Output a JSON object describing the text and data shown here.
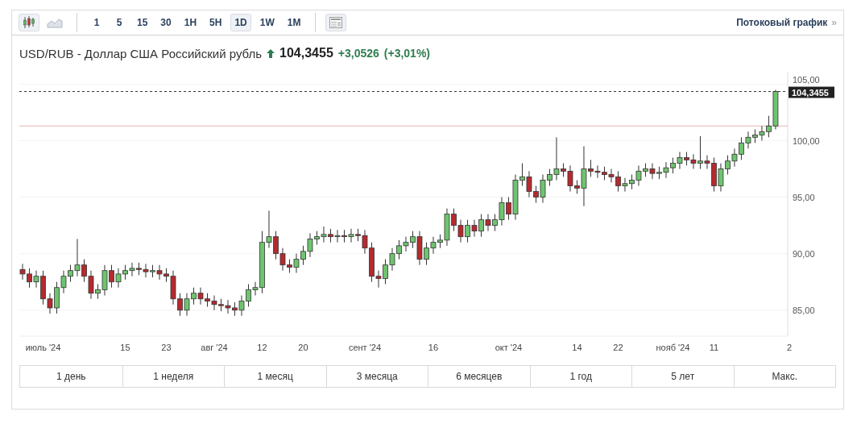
{
  "toolbar": {
    "chart_types": [
      {
        "kind": "candlestick",
        "selected": true
      },
      {
        "kind": "area",
        "selected": false
      }
    ],
    "intervals": [
      {
        "label": "1",
        "selected": false
      },
      {
        "label": "5",
        "selected": false
      },
      {
        "label": "15",
        "selected": false
      },
      {
        "label": "30",
        "selected": false
      },
      {
        "label": "1H",
        "selected": false
      },
      {
        "label": "5H",
        "selected": false
      },
      {
        "label": "1D",
        "selected": true
      },
      {
        "label": "1W",
        "selected": false
      },
      {
        "label": "1M",
        "selected": false
      }
    ],
    "streaming_link": {
      "label": "Потоковый график",
      "arrow": "»"
    }
  },
  "quote": {
    "pair": "USD/RUB - Доллар США Российский рубль",
    "price": "104,3455",
    "change": "+3,0526",
    "change_percent": "(+3,01%)"
  },
  "chart": {
    "chart_data": {
      "type": "candlestick",
      "ylim": [
        82.7,
        106.1
      ],
      "yticks": [
        {
          "value": 85,
          "label": "85,00"
        },
        {
          "value": 90,
          "label": "90,00"
        },
        {
          "value": 95,
          "label": "95,00"
        },
        {
          "value": 100,
          "label": "100,00"
        },
        {
          "value": 105,
          "label": "105,00"
        }
      ],
      "categories": [
        null,
        null,
        null,
        "июль '24",
        null,
        null,
        null,
        null,
        null,
        null,
        null,
        null,
        null,
        null,
        null,
        "15",
        null,
        null,
        null,
        null,
        null,
        "23",
        null,
        null,
        null,
        null,
        null,
        null,
        "авг '24",
        null,
        null,
        null,
        null,
        null,
        null,
        "12",
        null,
        null,
        null,
        null,
        null,
        "20",
        null,
        null,
        null,
        null,
        null,
        null,
        null,
        null,
        "сент '24",
        null,
        null,
        null,
        null,
        null,
        null,
        null,
        null,
        null,
        "16",
        null,
        null,
        null,
        null,
        null,
        null,
        null,
        null,
        null,
        null,
        "окт '24",
        null,
        null,
        null,
        null,
        null,
        null,
        null,
        null,
        null,
        "14",
        null,
        null,
        null,
        null,
        null,
        "22",
        null,
        null,
        null,
        null,
        null,
        null,
        null,
        "нояб '24",
        null,
        null,
        null,
        null,
        null,
        "11",
        null,
        null,
        null,
        null,
        null,
        null,
        null,
        null,
        null,
        null,
        "2"
      ],
      "ohlc": [
        [
          88.6,
          89.1,
          87.7,
          88.2
        ],
        [
          88.2,
          88.7,
          87.0,
          87.5
        ],
        [
          87.5,
          88.5,
          87.0,
          88.0
        ],
        [
          88.0,
          88.5,
          85.5,
          86.0
        ],
        [
          86.0,
          86.5,
          84.7,
          85.2
        ],
        [
          85.2,
          87.5,
          84.7,
          87.0
        ],
        [
          87.0,
          88.5,
          86.5,
          88.0
        ],
        [
          88.0,
          89.0,
          87.5,
          88.5
        ],
        [
          88.5,
          91.3,
          88.0,
          89.0
        ],
        [
          89.0,
          89.5,
          87.5,
          88.0
        ],
        [
          88.0,
          88.5,
          86.0,
          86.5
        ],
        [
          86.5,
          87.3,
          86.0,
          86.8
        ],
        [
          86.8,
          89.0,
          86.3,
          88.5
        ],
        [
          88.5,
          89.0,
          87.0,
          87.5
        ],
        [
          87.5,
          88.7,
          87.0,
          88.2
        ],
        [
          88.2,
          89.0,
          87.7,
          88.5
        ],
        [
          88.5,
          89.2,
          88.0,
          88.7
        ],
        [
          88.7,
          89.2,
          88.1,
          88.6
        ],
        [
          88.6,
          89.1,
          87.9,
          88.4
        ],
        [
          88.4,
          89.0,
          87.9,
          88.5
        ],
        [
          88.5,
          89.0,
          87.7,
          88.2
        ],
        [
          88.2,
          88.7,
          87.5,
          88.0
        ],
        [
          88.0,
          88.5,
          85.5,
          86.0
        ],
        [
          86.0,
          86.5,
          84.5,
          85.0
        ],
        [
          85.0,
          86.5,
          84.5,
          86.0
        ],
        [
          86.0,
          87.0,
          85.5,
          86.5
        ],
        [
          86.5,
          87.0,
          85.5,
          86.0
        ],
        [
          86.0,
          86.5,
          85.3,
          85.8
        ],
        [
          85.8,
          86.3,
          85.0,
          85.5
        ],
        [
          85.5,
          86.0,
          84.9,
          85.4
        ],
        [
          85.4,
          85.9,
          84.7,
          85.2
        ],
        [
          85.2,
          85.7,
          84.5,
          85.0
        ],
        [
          85.0,
          86.3,
          84.5,
          85.8
        ],
        [
          85.8,
          87.3,
          85.3,
          86.8
        ],
        [
          86.8,
          87.5,
          86.3,
          87.0
        ],
        [
          87.0,
          92.0,
          86.5,
          91.0
        ],
        [
          91.0,
          93.8,
          90.5,
          91.5
        ],
        [
          91.5,
          92.0,
          89.5,
          90.0
        ],
        [
          90.0,
          90.5,
          88.5,
          89.0
        ],
        [
          89.0,
          89.5,
          88.3,
          88.8
        ],
        [
          88.8,
          90.0,
          88.3,
          89.5
        ],
        [
          89.5,
          90.7,
          89.0,
          90.2
        ],
        [
          90.2,
          91.8,
          89.7,
          91.3
        ],
        [
          91.3,
          92.0,
          90.8,
          91.5
        ],
        [
          91.5,
          92.4,
          91.0,
          91.7
        ],
        [
          91.7,
          92.2,
          91.0,
          91.5
        ],
        [
          91.5,
          92.1,
          91.0,
          91.6
        ],
        [
          91.6,
          92.1,
          91.0,
          91.5
        ],
        [
          91.5,
          92.2,
          91.0,
          91.7
        ],
        [
          91.7,
          92.2,
          91.1,
          91.6
        ],
        [
          91.6,
          92.1,
          90.0,
          90.5
        ],
        [
          90.5,
          91.0,
          87.5,
          88.0
        ],
        [
          88.0,
          88.5,
          87.0,
          87.8
        ],
        [
          87.8,
          89.5,
          87.3,
          89.0
        ],
        [
          89.0,
          90.5,
          88.5,
          90.0
        ],
        [
          90.0,
          91.2,
          89.5,
          90.7
        ],
        [
          90.7,
          91.5,
          90.2,
          91.0
        ],
        [
          91.0,
          92.0,
          90.5,
          91.5
        ],
        [
          91.5,
          92.0,
          89.0,
          89.5
        ],
        [
          89.5,
          91.0,
          89.0,
          90.5
        ],
        [
          90.5,
          91.5,
          90.0,
          91.0
        ],
        [
          91.0,
          91.7,
          90.5,
          91.2
        ],
        [
          91.2,
          94.0,
          90.7,
          93.5
        ],
        [
          93.5,
          94.0,
          92.0,
          92.5
        ],
        [
          92.5,
          93.0,
          91.0,
          91.5
        ],
        [
          91.5,
          93.0,
          91.0,
          92.5
        ],
        [
          92.5,
          93.0,
          91.5,
          92.0
        ],
        [
          92.0,
          93.5,
          91.5,
          93.0
        ],
        [
          93.0,
          93.5,
          92.0,
          92.5
        ],
        [
          92.5,
          93.5,
          92.0,
          93.0
        ],
        [
          93.0,
          95.0,
          92.5,
          94.5
        ],
        [
          94.5,
          95.0,
          93.0,
          93.5
        ],
        [
          93.5,
          97.0,
          93.0,
          96.5
        ],
        [
          96.5,
          98.0,
          96.0,
          96.8
        ],
        [
          96.8,
          97.3,
          95.0,
          95.5
        ],
        [
          95.5,
          96.0,
          94.5,
          95.0
        ],
        [
          95.0,
          97.0,
          94.5,
          96.5
        ],
        [
          96.5,
          97.5,
          96.0,
          97.0
        ],
        [
          97.0,
          100.3,
          96.5,
          97.5
        ],
        [
          97.5,
          98.0,
          96.8,
          97.3
        ],
        [
          97.3,
          97.8,
          95.5,
          96.0
        ],
        [
          96.0,
          96.5,
          95.3,
          95.8
        ],
        [
          95.8,
          99.5,
          94.2,
          97.5
        ],
        [
          97.5,
          98.3,
          96.8,
          97.3
        ],
        [
          97.3,
          97.8,
          96.7,
          97.2
        ],
        [
          97.2,
          97.7,
          96.5,
          97.0
        ],
        [
          97.0,
          97.5,
          96.3,
          96.8
        ],
        [
          96.8,
          97.3,
          95.5,
          96.0
        ],
        [
          96.0,
          96.7,
          95.5,
          96.2
        ],
        [
          96.2,
          97.0,
          95.7,
          96.5
        ],
        [
          96.5,
          97.8,
          96.0,
          97.3
        ],
        [
          97.3,
          98.0,
          96.8,
          97.5
        ],
        [
          97.5,
          98.0,
          96.6,
          97.1
        ],
        [
          97.1,
          97.7,
          96.6,
          97.2
        ],
        [
          97.2,
          98.1,
          96.7,
          97.6
        ],
        [
          97.6,
          98.5,
          97.1,
          98.0
        ],
        [
          98.0,
          99.0,
          97.5,
          98.5
        ],
        [
          98.5,
          99.0,
          97.8,
          98.3
        ],
        [
          98.3,
          98.8,
          97.5,
          98.0
        ],
        [
          98.0,
          100.4,
          97.5,
          98.2
        ],
        [
          98.2,
          98.7,
          97.5,
          98.0
        ],
        [
          98.0,
          98.5,
          95.5,
          96.0
        ],
        [
          96.0,
          98.0,
          95.5,
          97.5
        ],
        [
          97.5,
          98.7,
          97.0,
          98.2
        ],
        [
          98.2,
          99.3,
          97.7,
          98.8
        ],
        [
          98.8,
          100.3,
          98.3,
          99.8
        ],
        [
          99.8,
          100.8,
          99.3,
          100.3
        ],
        [
          100.3,
          101.0,
          99.8,
          100.5
        ],
        [
          100.5,
          101.3,
          100.0,
          100.8
        ],
        [
          100.8,
          102.2,
          100.3,
          101.3
        ],
        [
          101.3,
          104.5,
          101.0,
          104.35
        ],
        null,
        null
      ],
      "ref_lines": [
        {
          "axis": "y",
          "value": 101.3
        },
        {
          "axis": "y",
          "value": 104.35,
          "label": "104,3455"
        }
      ],
      "grid": true
    }
  },
  "ranges": [
    "1 день",
    "1 неделя",
    "1 месяц",
    "3 месяца",
    "6 месяцев",
    "1 год",
    "5 лет",
    "Макс."
  ]
}
